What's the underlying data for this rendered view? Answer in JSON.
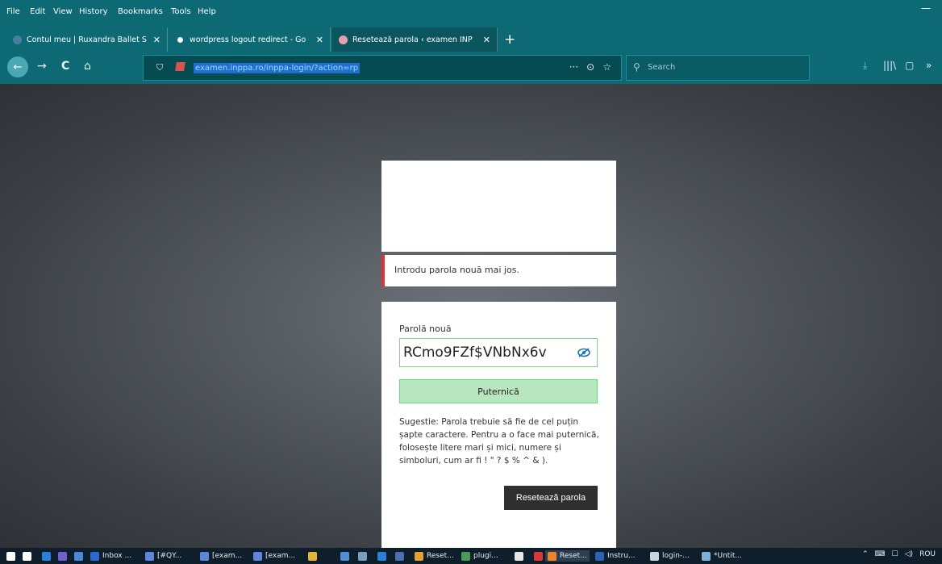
{
  "menubar": {
    "items": [
      "File",
      "Edit",
      "View",
      "History",
      "Bookmarks",
      "Tools",
      "Help"
    ],
    "minimize": "—"
  },
  "tabs": [
    {
      "label": "Contul meu | Ruxandra Ballet S",
      "close": "✕",
      "icon_color": "#4a7ea0"
    },
    {
      "label": "wordpress logout redirect - Go",
      "close": "✕",
      "icon_color": "#ffffff"
    },
    {
      "label": "Resetează parola ‹ examen INP",
      "close": "✕",
      "icon_color": "#e6a0b0"
    }
  ],
  "new_tab": "+",
  "navbar": {
    "back": "←",
    "forward": "→",
    "reload": "C",
    "home": "⌂",
    "url": "examen.inppa.ro/inppa-login/?action=rp",
    "more": "···",
    "pocket": "⊙",
    "bookmark": "☆",
    "search_placeholder": "Search",
    "search_icon": "⚲",
    "download": "⤓",
    "library": "|||\\",
    "sidebar": "▢",
    "overflow": "»"
  },
  "login": {
    "message": "Introdu parola nouă mai jos.",
    "field_label": "Parolă nouă",
    "password_value": "RCmo9FZf$VNbNx6v",
    "strength": "Puternică",
    "hint": "Sugestie: Parola trebuie să fie de cel puțin șapte caractere. Pentru a o face mai puternică, folosește litere mari și mici, numere și simboluri, cum ar fi ! \" ? $ % ^ & ).",
    "submit": "Resetează parola"
  },
  "taskbar": {
    "items": [
      {
        "label": "",
        "color": "#ffffff"
      },
      {
        "label": "",
        "color": "#ffffff"
      },
      {
        "label": "",
        "color": "#2a7fd8"
      },
      {
        "label": "",
        "color": "#6f5fd0"
      },
      {
        "label": "",
        "color": "#4a8ad4"
      },
      {
        "label": "Inbox ...",
        "color": "#2a6ad0"
      },
      {
        "label": "[#QY...",
        "color": "#5f86d8"
      },
      {
        "label": "[exam...",
        "color": "#5f86d8"
      },
      {
        "label": "[exam...",
        "color": "#5f86d8"
      },
      {
        "label": "",
        "color": "#e6b33a"
      },
      {
        "label": "",
        "color": "#4f8fd6"
      },
      {
        "label": "",
        "color": "#7a9fb8"
      },
      {
        "label": "",
        "color": "#2a7fd8"
      },
      {
        "label": "",
        "color": "#4a6fb5"
      },
      {
        "label": "Reset...",
        "color": "#e5a034"
      },
      {
        "label": "plugi...",
        "color": "#4a9a5a"
      },
      {
        "label": "",
        "color": "#e6e6e6"
      },
      {
        "label": "",
        "color": "#d83a3a"
      },
      {
        "label": "Reset...",
        "color": "#f0822a"
      },
      {
        "label": "Instru...",
        "color": "#2b63b6"
      },
      {
        "label": "login-...",
        "color": "#c8d6e0"
      },
      {
        "label": "*Untit...",
        "color": "#7fb0d8"
      }
    ],
    "tray": [
      "⌃",
      "⌨",
      "☐",
      "◁)",
      "ROU"
    ]
  }
}
